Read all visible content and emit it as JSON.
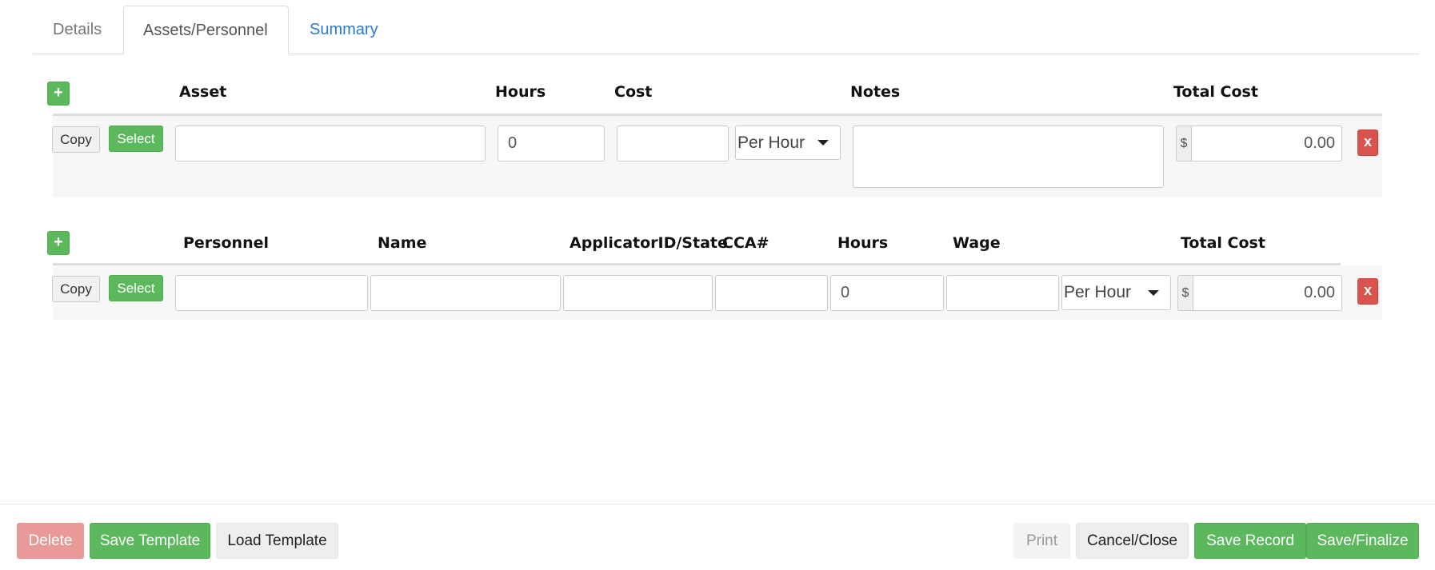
{
  "tabs": [
    {
      "label": "Details"
    },
    {
      "label": "Assets/Personnel"
    },
    {
      "label": "Summary"
    }
  ],
  "assets": {
    "add_label": "+",
    "headers": {
      "asset": "Asset",
      "hours": "Hours",
      "cost": "Cost",
      "notes": "Notes",
      "total_cost": "Total Cost"
    },
    "row": {
      "copy_label": "Copy",
      "select_label": "Select",
      "asset_value": "",
      "hours_value": "0",
      "cost_value": "",
      "rate_unit": "Per Hour",
      "notes_value": "",
      "currency_symbol": "$",
      "total_value": "0.00",
      "remove_label": "x"
    }
  },
  "personnel": {
    "add_label": "+",
    "headers": {
      "personnel": "Personnel",
      "name": "Name",
      "applicator": "ApplicatorID/State",
      "cca": "CCA#",
      "hours": "Hours",
      "wage": "Wage",
      "total_cost": "Total Cost"
    },
    "row": {
      "copy_label": "Copy",
      "select_label": "Select",
      "personnel_value": "",
      "name_value": "",
      "applicator_value": "",
      "cca_value": "",
      "hours_value": "0",
      "wage_value": "",
      "rate_unit": "Per Hour",
      "currency_symbol": "$",
      "total_value": "0.00",
      "remove_label": "x"
    }
  },
  "footer": {
    "delete": "Delete",
    "save_template": "Save Template",
    "load_template": "Load Template",
    "print": "Print",
    "cancel_close": "Cancel/Close",
    "save_record": "Save Record",
    "save_finalize": "Save/Finalize"
  },
  "colors": {
    "primary_green": "#5cb85c",
    "danger_red": "#d9534f",
    "link_blue": "#2a7ad6"
  }
}
